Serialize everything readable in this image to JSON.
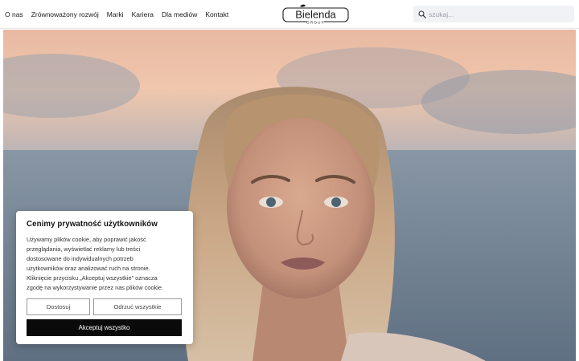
{
  "nav": {
    "items": [
      {
        "label": "O nas"
      },
      {
        "label": "Zrównoważony rozwój"
      },
      {
        "label": "Marki"
      },
      {
        "label": "Kariera"
      },
      {
        "label": "Dla mediów"
      },
      {
        "label": "Kontakt"
      }
    ]
  },
  "logo": {
    "brand": "Bielenda",
    "sub": "GROUP"
  },
  "search": {
    "placeholder": "szukaj..."
  },
  "hero": {
    "image": "woman-portrait-by-sea-at-sunset"
  },
  "cookie": {
    "title": "Cenimy prywatność użytkowników",
    "body_lines": [
      "Używamy plików cookie, aby poprawić jakość",
      "przeglądania, wyświetlać reklamy lub treści",
      "dostosowane do indywidualnych potrzeb",
      "użytkowników oraz analizować ruch na stronie.",
      "Kliknięcie przycisku „Akceptuj wszystkie” oznacza",
      "zgodę na wykorzystywanie przez nas plików cookie."
    ],
    "customize_label": "Dostosuj",
    "reject_label": "Odrzuć wszystkie",
    "accept_label": "Akceptuj wszystko"
  },
  "colors": {
    "accent": "#0a0a0a",
    "search_bg": "#f1f2f5"
  }
}
